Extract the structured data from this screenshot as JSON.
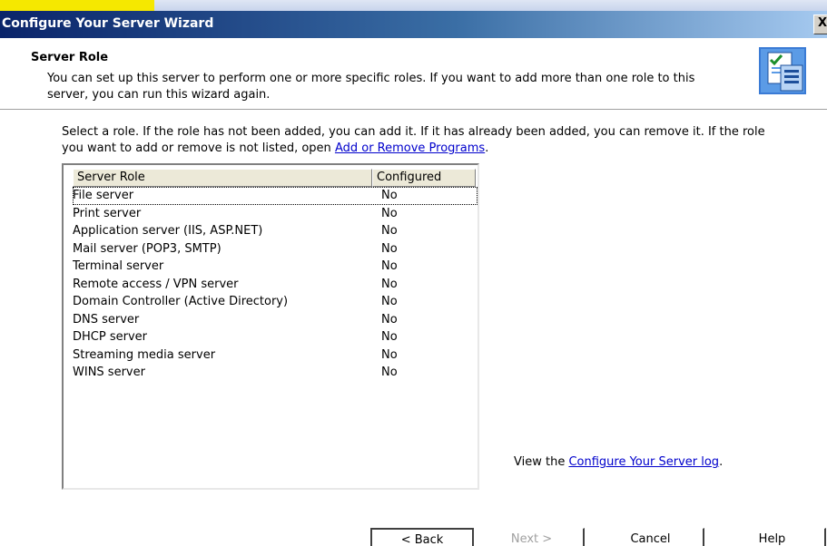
{
  "window": {
    "title": "Configure Your Server Wizard",
    "close_glyph": "X"
  },
  "header": {
    "title": "Server Role",
    "description": "You can set up this server to perform one or more specific roles. If you want to add more than one role to this server, you can run this wizard again.",
    "icon": "wizard-checklist-icon"
  },
  "instructions": {
    "text_before_link": "Select a role. If the role has not been added, you can add it. If it has already been added, you can remove it. If the role you want to add or remove is not listed, open ",
    "link": "Add or Remove Programs",
    "text_after_link": "."
  },
  "listview": {
    "columns": [
      "Server Role",
      "Configured"
    ],
    "rows": [
      {
        "role": "File server",
        "configured": "No"
      },
      {
        "role": "Print server",
        "configured": "No"
      },
      {
        "role": "Application server (IIS, ASP.NET)",
        "configured": "No"
      },
      {
        "role": "Mail server (POP3, SMTP)",
        "configured": "No"
      },
      {
        "role": "Terminal server",
        "configured": "No"
      },
      {
        "role": "Remote access / VPN server",
        "configured": "No"
      },
      {
        "role": "Domain Controller (Active Directory)",
        "configured": "No"
      },
      {
        "role": "DNS server",
        "configured": "No"
      },
      {
        "role": "DHCP server",
        "configured": "No"
      },
      {
        "role": "Streaming media server",
        "configured": "No"
      },
      {
        "role": "WINS server",
        "configured": "No"
      }
    ]
  },
  "log": {
    "text_before_link": "View the ",
    "link": "Configure Your Server log",
    "text_after_link": "."
  },
  "buttons": {
    "back": "< Back",
    "next": "Next >",
    "cancel": "Cancel",
    "help": "Help"
  },
  "colors": {
    "titlebar_start": "#0a246a",
    "titlebar_end": "#a6caf0",
    "link": "#0000cc",
    "disabled_text": "#a0a0a0"
  }
}
